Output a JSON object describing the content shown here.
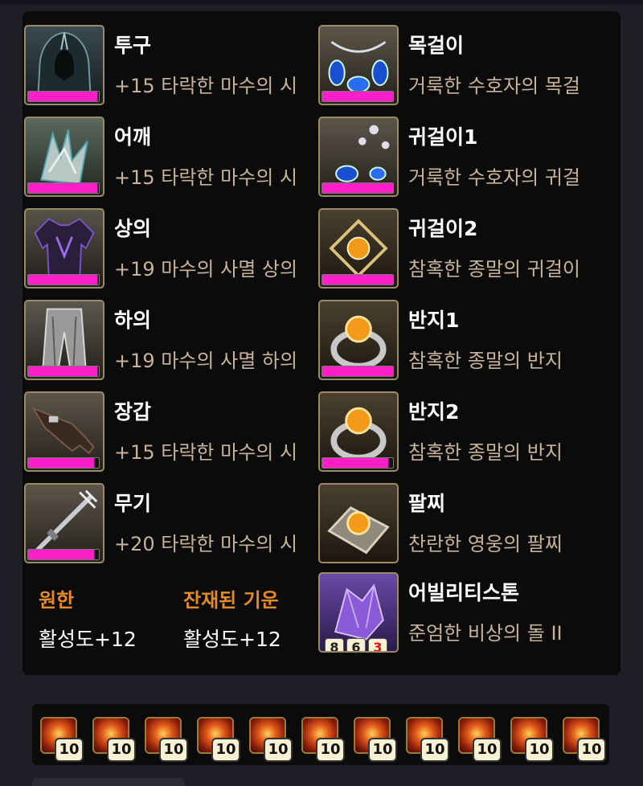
{
  "equipment": {
    "left": [
      {
        "slot": "투구",
        "name": "+15 타락한 마수의 시",
        "quality": 0.98
      },
      {
        "slot": "어깨",
        "name": "+15 타락한 마수의 시",
        "quality": 0.98
      },
      {
        "slot": "상의",
        "name": "+19 마수의 사멸 상의",
        "quality": 0.98
      },
      {
        "slot": "하의",
        "name": "+19 마수의 사멸 하의",
        "quality": 0.98
      },
      {
        "slot": "장갑",
        "name": "+15 타락한 마수의 시",
        "quality": 0.93
      },
      {
        "slot": "무기",
        "name": "+20 타락한 마수의 시",
        "quality": 0.93
      }
    ],
    "right": [
      {
        "slot": "목걸이",
        "name": "거룩한 수호자의 목걸",
        "quality": 1.0
      },
      {
        "slot": "귀걸이1",
        "name": "거룩한 수호자의 귀걸",
        "quality": 1.0
      },
      {
        "slot": "귀걸이2",
        "name": "참혹한 종말의 귀걸이",
        "quality": 1.0
      },
      {
        "slot": "반지1",
        "name": "참혹한 종말의 반지",
        "quality": 1.0
      },
      {
        "slot": "반지2",
        "name": "참혹한 종말의 반지",
        "quality": 0.93
      },
      {
        "slot": "팔찌",
        "name": "찬란한 영웅의 팔찌"
      }
    ],
    "stone": {
      "slot": "어빌리티스톤",
      "name": "준엄한 비상의 돌 II",
      "engravings": [
        "8",
        "6",
        "3"
      ]
    }
  },
  "stats": [
    {
      "title": "원한",
      "value": "활성도+12"
    },
    {
      "title": "잔재된 기운",
      "value": "활성도+12"
    }
  ],
  "consumables": [
    {
      "count": "10"
    },
    {
      "count": "10"
    },
    {
      "count": "10"
    },
    {
      "count": "10"
    },
    {
      "count": "10"
    },
    {
      "count": "10"
    },
    {
      "count": "10"
    },
    {
      "count": "10"
    },
    {
      "count": "10"
    },
    {
      "count": "10"
    },
    {
      "count": "10"
    }
  ],
  "colors": {
    "quality_bar": "#ff1fc8",
    "stat_title": "#e58a24",
    "item_name": "#c8b39a",
    "panel_bg": "#0b0b0b"
  }
}
